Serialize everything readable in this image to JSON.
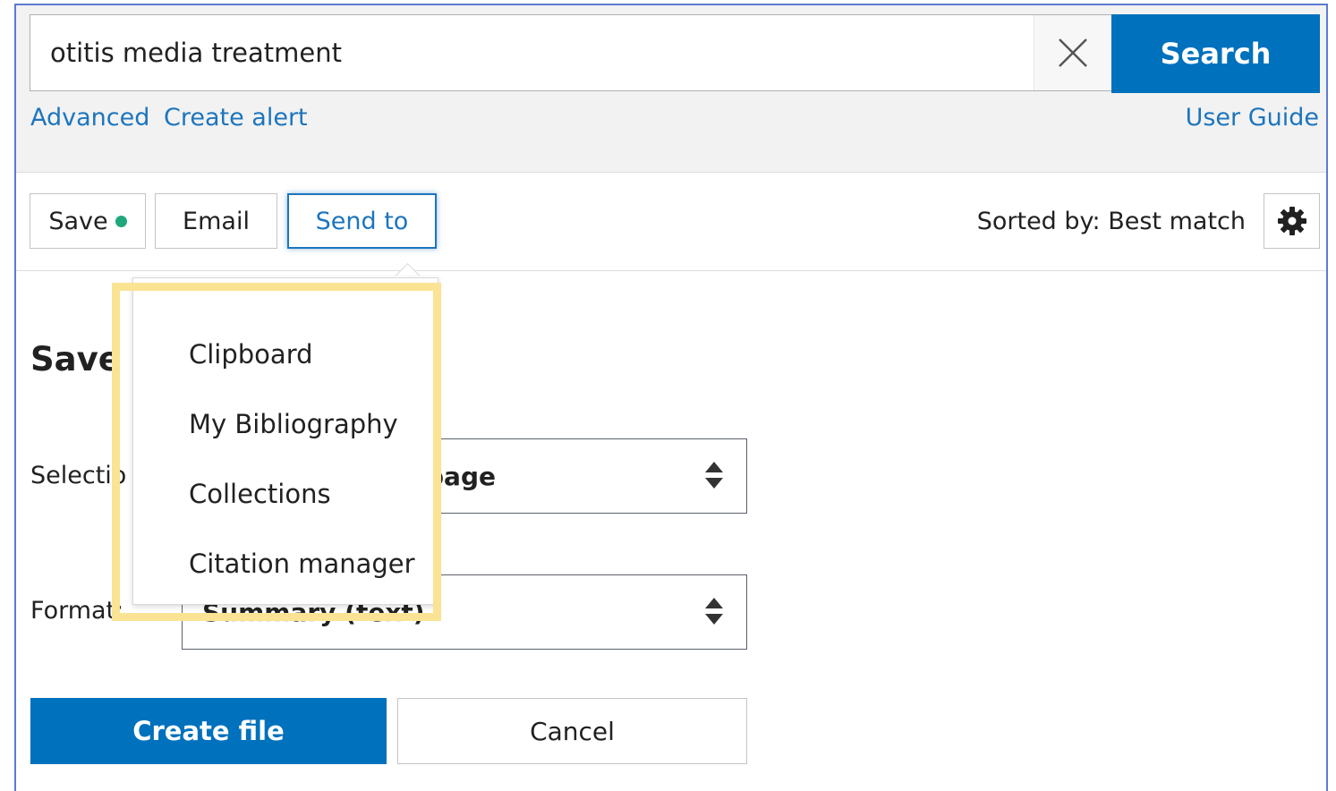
{
  "search": {
    "value": "otitis media treatment",
    "button_label": "Search"
  },
  "links": {
    "advanced": "Advanced",
    "create_alert": "Create alert",
    "user_guide": "User Guide"
  },
  "toolbar": {
    "save_label": "Save",
    "email_label": "Email",
    "send_to_label": "Send to",
    "sorted_by": "Sorted by: Best match"
  },
  "panel": {
    "title": "Save c",
    "selection_label": "Selectio",
    "selection_value": "page",
    "format_label": "Format:",
    "format_value": "Summary (text)",
    "create_file_label": "Create file",
    "cancel_label": "Cancel"
  },
  "send_to_menu": {
    "items": [
      "Clipboard",
      "My Bibliography",
      "Collections",
      "Citation manager"
    ]
  },
  "colors": {
    "primary": "#0071bc",
    "link": "#1d75bd",
    "save_dot": "#20a77e",
    "highlight": "#fbe394",
    "frame_border": "#5b7bd5"
  },
  "icons": {
    "clear": "close-icon",
    "settings": "gear-icon",
    "select_arrows": "sort-arrows-icon"
  }
}
